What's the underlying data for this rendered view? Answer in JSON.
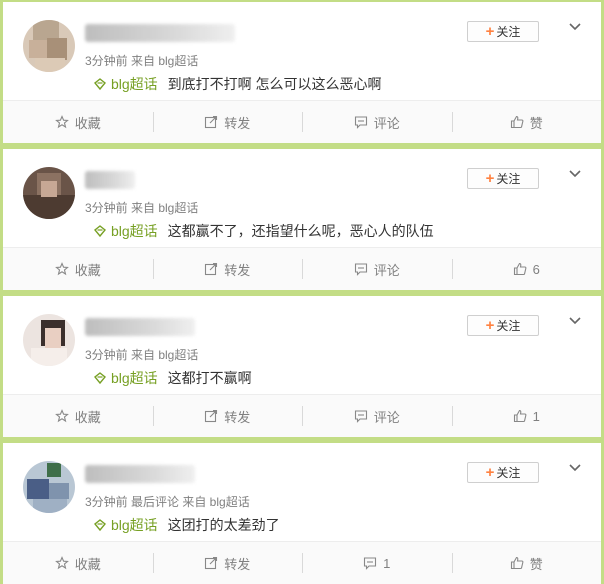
{
  "ui": {
    "follow_label": "关注",
    "actions": {
      "collect": "收藏",
      "repost": "转发",
      "comment": "评论",
      "like": "赞"
    }
  },
  "colors": {
    "page_bg": "#c3dd86",
    "topic": "#77a024",
    "follow_plus": "#ff8140"
  },
  "cards": [
    {
      "meta": "3分钟前 来自 blg超话",
      "topic": "blg超话",
      "text": "到底打不打啊 怎么可以这么恶心啊",
      "comment_label": "评论",
      "like_label": "赞"
    },
    {
      "meta": "3分钟前 来自 blg超话",
      "topic": "blg超话",
      "text": "这都赢不了，还指望什么呢，恶心人的队伍",
      "comment_label": "评论",
      "like_label": "6"
    },
    {
      "meta": "3分钟前 来自 blg超话",
      "topic": "blg超话",
      "text": "这都打不赢啊",
      "comment_label": "评论",
      "like_label": "1"
    },
    {
      "meta": "3分钟前 最后评论 来自 blg超话",
      "topic": "blg超话",
      "text": "这团打的太差劲了",
      "comment_label": "1",
      "like_label": "赞"
    }
  ]
}
